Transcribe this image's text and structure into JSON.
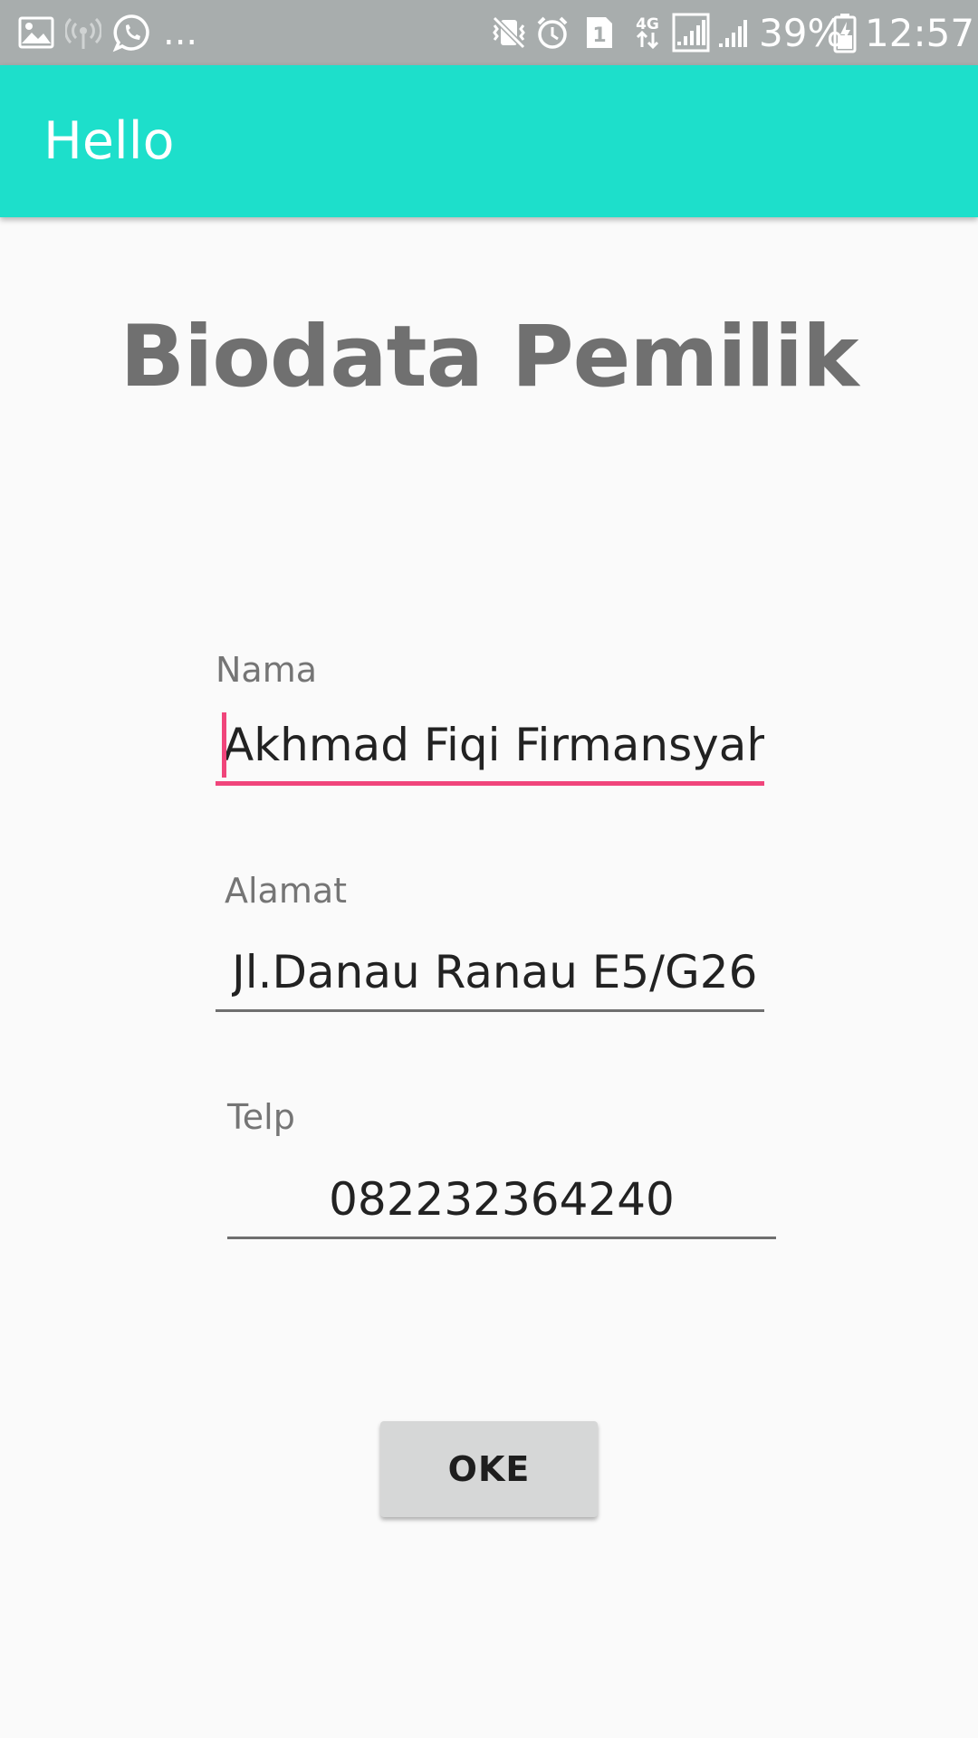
{
  "status_bar": {
    "icons": [
      "gallery-icon",
      "hotspot-icon",
      "whatsapp-icon",
      "more-dots",
      "mute-vibrate-icon",
      "alarm-icon",
      "sim1-icon",
      "network-4g-icon",
      "signal-icon",
      "signal2-icon",
      "battery-charging-icon"
    ],
    "more_notifications": "...",
    "battery_percent": "39%",
    "time": "12:57"
  },
  "app_bar": {
    "title": "Hello",
    "color": "#1ddfcb"
  },
  "main": {
    "heading": "Biodata Pemilik",
    "fields": {
      "nama": {
        "label": "Nama",
        "value": "Akhmad Fiqi Firmansyah"
      },
      "alamat": {
        "label": "Alamat",
        "value": "Jl.Danau Ranau E5/G26"
      },
      "telp": {
        "label": "Telp",
        "value": "082232364240"
      }
    },
    "ok_button": "OKE",
    "accent_color": "#f0457b"
  }
}
